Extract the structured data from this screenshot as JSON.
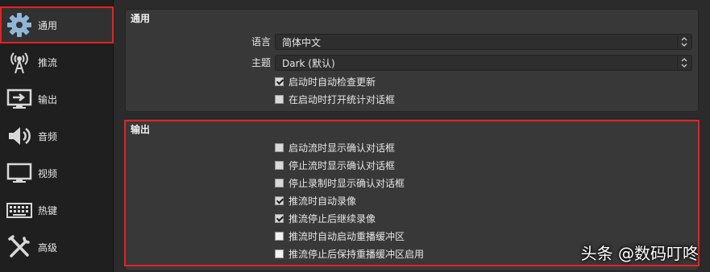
{
  "sidebar": {
    "items": [
      {
        "label": "通用",
        "icon": "gear-icon",
        "selected": true
      },
      {
        "label": "推流",
        "icon": "antenna-icon"
      },
      {
        "label": "输出",
        "icon": "output-monitor-icon"
      },
      {
        "label": "音频",
        "icon": "speaker-icon"
      },
      {
        "label": "视频",
        "icon": "monitor-icon"
      },
      {
        "label": "热键",
        "icon": "keyboard-icon"
      },
      {
        "label": "高级",
        "icon": "tools-icon"
      }
    ]
  },
  "general_group": {
    "title": "通用",
    "language_label": "语言",
    "language_value": "简体中文",
    "theme_label": "主题",
    "theme_value": "Dark (默认)",
    "checkboxes": [
      {
        "label": "启动时自动检查更新",
        "checked": true
      },
      {
        "label": "在启动时打开统计对话框",
        "checked": false
      }
    ]
  },
  "output_group": {
    "title": "输出",
    "checkboxes": [
      {
        "label": "启动流时显示确认对话框",
        "checked": false
      },
      {
        "label": "停止流时显示确认对话框",
        "checked": false
      },
      {
        "label": "停止录制时显示确认对话框",
        "checked": false
      },
      {
        "label": "推流时自动录像",
        "checked": true
      },
      {
        "label": "推流停止后继续录像",
        "checked": true
      },
      {
        "label": "推流时自动启动重播缓冲区",
        "checked": false
      },
      {
        "label": "推流停止后保持重播缓冲区启用",
        "checked": false
      }
    ]
  },
  "watermark": "头条 @数码叮咚",
  "colors": {
    "highlight": "#e52222",
    "background": "#2b2b2b",
    "sidebar": "#1f1f1f"
  }
}
